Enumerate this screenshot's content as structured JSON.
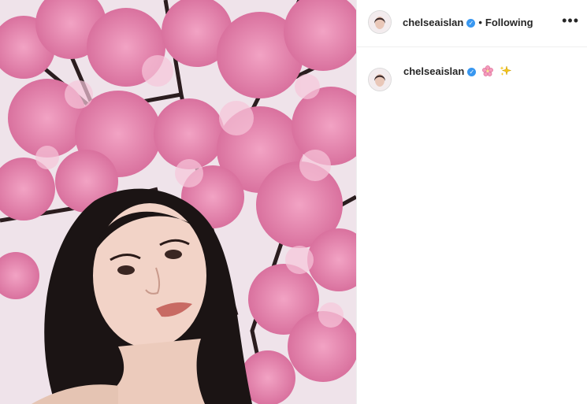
{
  "post": {
    "photo_icon": "photo-of-woman-under-cherry-blossoms",
    "accent": "#3897f0"
  },
  "header": {
    "username": "chelseaislan",
    "verified_icon": "verified-badge-icon",
    "separator": "•",
    "follow_status": "Following",
    "more_icon": "•••"
  },
  "caption": {
    "username": "chelseaislan",
    "verified_icon": "verified-badge-icon",
    "emojis": [
      "cherry-blossom-emoji",
      "sparkles-emoji"
    ]
  }
}
